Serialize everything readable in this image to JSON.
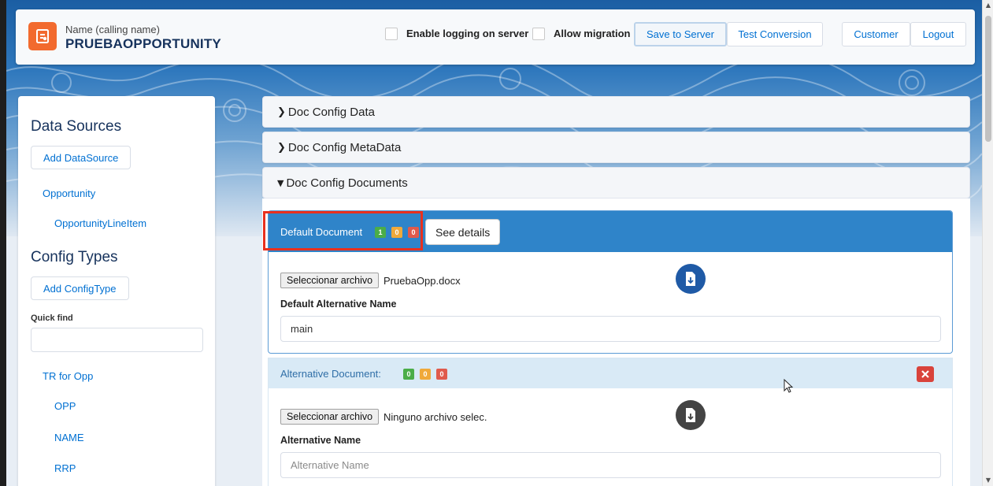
{
  "header": {
    "name_label": "Name (calling name)",
    "name_value": "PRUEBAOPPORTUNITY",
    "enable_logging_label": "Enable logging on server",
    "allow_migration_label": "Allow migration",
    "save_button": "Save to Server",
    "test_button": "Test Conversion",
    "customer_button": "Customer",
    "logout_button": "Logout"
  },
  "sidebar": {
    "data_sources_heading": "Data Sources",
    "add_datasource_button": "Add DataSource",
    "datasources": [
      "Opportunity",
      "OpportunityLineItem"
    ],
    "config_types_heading": "Config Types",
    "add_configtype_button": "Add ConfigType",
    "quick_find_label": "Quick find",
    "config_items": [
      "TR for Opp",
      "OPP",
      "NAME",
      "RRP"
    ]
  },
  "accordion": {
    "data": "Doc Config Data",
    "metadata": "Doc Config MetaData",
    "documents": "Doc Config Documents"
  },
  "default_document": {
    "title": "Default Document",
    "badges": [
      "1",
      "0",
      "0"
    ],
    "see_details": "See details",
    "file_button": "Seleccionar archivo",
    "file_name": "PruebaOpp.docx",
    "alt_name_label": "Default Alternative Name",
    "alt_name_value": "main"
  },
  "alternative_document": {
    "title": "Alternative Document:",
    "badges": [
      "0",
      "0",
      "0"
    ],
    "file_button": "Seleccionar archivo",
    "file_name": "Ninguno archivo selec.",
    "alt_name_label": "Alternative Name",
    "alt_name_placeholder": "Alternative Name"
  },
  "colors": {
    "accent": "#0070d2",
    "brand_orange": "#f26a2e",
    "header_blue": "#2f84c9",
    "badge_green": "#4bad48",
    "badge_orange": "#f0a93a",
    "badge_red": "#e05a4c",
    "highlight_red": "#e8301e"
  }
}
